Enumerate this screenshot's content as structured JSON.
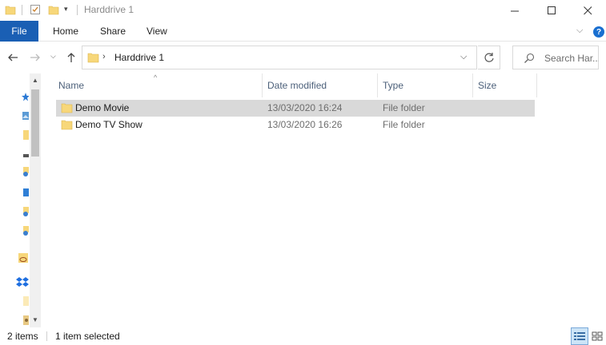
{
  "window": {
    "title": "Harddrive 1"
  },
  "ribbon": {
    "file_label": "File",
    "tabs": [
      "Home",
      "Share",
      "View"
    ],
    "help_label": "?"
  },
  "address": {
    "path_label": "Harddrive 1",
    "search_placeholder": "Search Har..."
  },
  "columns": {
    "name": "Name",
    "date_modified": "Date modified",
    "type": "Type",
    "size": "Size"
  },
  "files": [
    {
      "name": "Demo Movie",
      "date_modified": "13/03/2020 16:24",
      "type": "File folder",
      "selected": true
    },
    {
      "name": "Demo TV Show",
      "date_modified": "13/03/2020 16:26",
      "type": "File folder",
      "selected": false
    }
  ],
  "status": {
    "item_count": "2 items",
    "selection": "1 item selected"
  },
  "colors": {
    "accent": "#1a5fb4",
    "folder": "#f7d77a",
    "selected_row": "#d9d9d9"
  },
  "icons": [
    "folder-icon",
    "properties-icon",
    "back-arrow-icon",
    "forward-arrow-icon",
    "up-arrow-icon",
    "refresh-icon",
    "search-icon",
    "minimize-icon",
    "maximize-icon",
    "close-icon",
    "details-view-icon",
    "large-icons-view-icon"
  ]
}
